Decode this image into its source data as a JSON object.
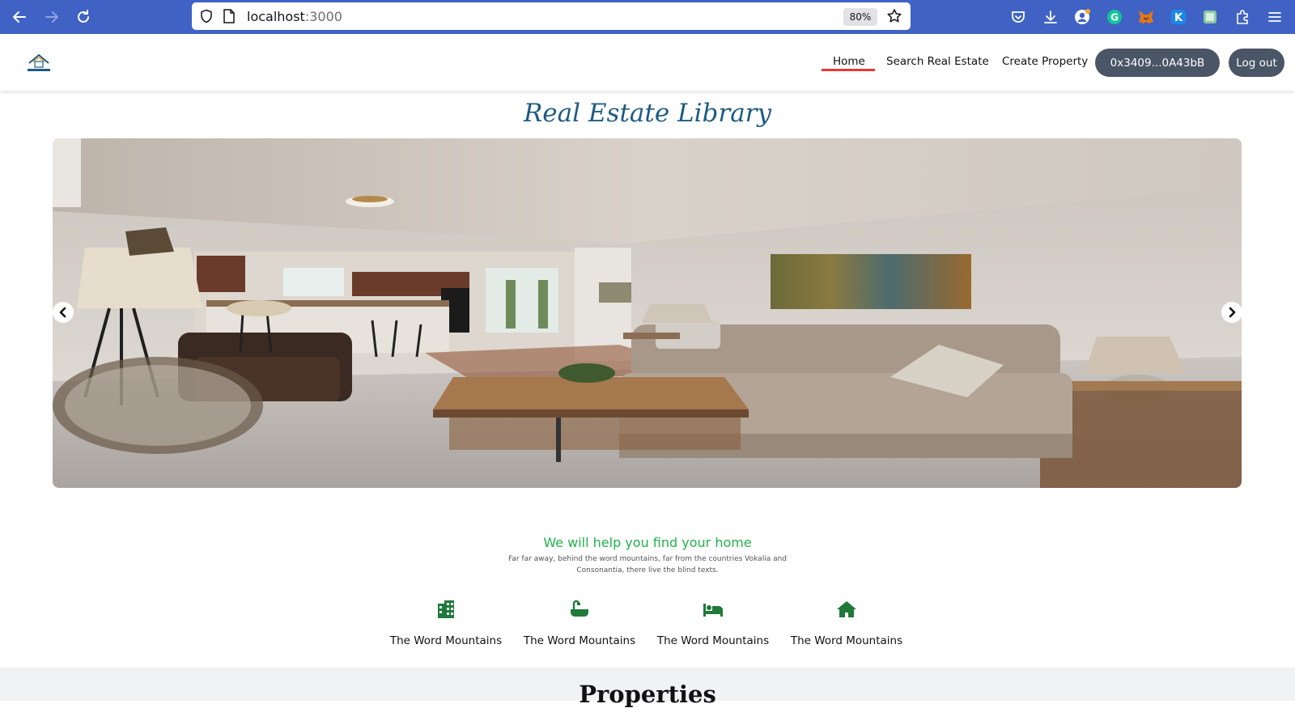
{
  "browser": {
    "url_host": "localhost",
    "url_port": ":3000",
    "zoom": "80%"
  },
  "header": {
    "nav": {
      "home": "Home",
      "search": "Search Real Estate",
      "create": "Create Property"
    },
    "wallet_address": "0x3409...0A43bB",
    "logout": "Log out"
  },
  "main": {
    "title": "Real Estate Library",
    "hero_image": "living-room-photo",
    "section": {
      "heading": "We will help you find your home",
      "subtext": "Far far away, behind the word mountains, far from the countries Vokalia and Consonantia, there live the blind texts."
    },
    "features": [
      {
        "icon": "building-icon",
        "label": "The Word Mountains"
      },
      {
        "icon": "bathtub-icon",
        "label": "The Word Mountains"
      },
      {
        "icon": "bed-icon",
        "label": "The Word Mountains"
      },
      {
        "icon": "house-icon",
        "label": "The Word Mountains"
      }
    ],
    "properties_title": "Properties"
  },
  "colors": {
    "browser_bar": "#3f62c4",
    "title": "#1d5b82",
    "accent_green": "#22b14c",
    "icon_green": "#1f7a3a",
    "active_underline": "#e53935",
    "pill": "#4a5566"
  }
}
